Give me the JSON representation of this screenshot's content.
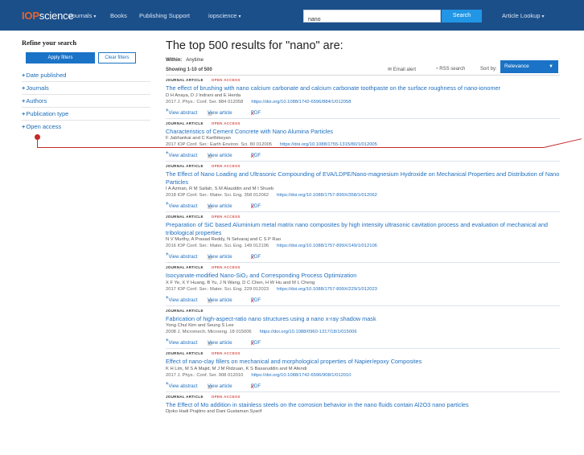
{
  "nav": {
    "logo_prefix": "IOP",
    "logo_suffix": "science",
    "items": [
      "Journals",
      "Books",
      "Publishing Support",
      "iopscience"
    ],
    "search_value": "nano",
    "search_button": "Search",
    "article_lookup": "Article Lookup"
  },
  "sidebar": {
    "title": "Refine your search",
    "apply": "Apply filters",
    "clear": "Clear filters",
    "filters": [
      "Date published",
      "Journals",
      "Authors",
      "Publication type",
      "Open access"
    ]
  },
  "main": {
    "heading": "The top 500 results for \"nano\" are:",
    "within_label": "Within:",
    "within_value": "Anytime",
    "showing": "Showing 1-10 of 500",
    "email_alert": "Email alert",
    "rss": "RSS search",
    "sort_label": "Sort by:",
    "sort_value": "Relevance"
  },
  "labels": {
    "type": "JOURNAL ARTICLE",
    "oa": "OPEN ACCESS",
    "view_abstract": "View abstract",
    "view_article": "View article",
    "pdf": "PDF"
  },
  "results": [
    {
      "title": "The effect of brushing with nano calcium carbonate and calcium carbonate toothpaste on the surface roughness of nano-ionomer",
      "authors": "D H Anaya, D J Indrani and E Herda",
      "cite": "2017 J. Phys.: Conf. Ser. 884 012058",
      "doi": "https://doi.org/10.1088/1742-6596/884/1/012058"
    },
    {
      "title": "Characteristics of Cement Concrete with Nano Alumina Particles",
      "authors": "F Jabhankai and C Karthikeyan",
      "cite": "2017 IOP Conf. Ser.: Earth Environ. Sci. 80 012005",
      "doi": "https://doi.org/10.1088/1755-1315/80/1/012005"
    },
    {
      "title": "The Effect of Nano Loading and Ultrasonic Compounding of EVA/LDPE/Nano-magnesium Hydroxide on Mechanical Properties and Distribution of Nano Particles",
      "authors": "I A Azman, R M Sallah, S M Alauddin and M I Shueb",
      "cite": "2018 IOP Conf. Ser.: Mater. Sci. Eng. 358 012062",
      "doi": "https://doi.org/10.1088/1757-899X/358/1/012062"
    },
    {
      "title": "Preparation of SiC based Aluminium metal matrix nano composites by high intensity ultrasonic cavitation process and evaluation of mechanical and tribological properties",
      "authors": "N V Murthy, A Prasad Reddy, N Selvaraj and C S P Rao",
      "cite": "2016 IOP Conf. Ser.: Mater. Sci. Eng. 149 012106",
      "doi": "https://doi.org/10.1088/1757-899X/149/1/012106"
    },
    {
      "title": "Isocyanate-modified Nano-SiO₂ and Corresponding Process Optimization",
      "authors": "X F Ye, X Y Huang, B Yu, J N Wang, D C Chen, H W Hu and M L Cheng",
      "cite": "2017 IOP Conf. Ser.: Mater. Sci. Eng. 229 012023",
      "doi": "https://doi.org/10.1088/1757-899X/229/1/012023"
    },
    {
      "title": "Fabrication of high-aspect-ratio nano structures using a nano x-ray shadow mask",
      "authors": "Yong Chul Kim and Seung S Lee",
      "cite": "2008 J. Micromech. Microeng. 18 015006",
      "doi": "https://doi.org/10.1088/0960-1317/18/1/015006"
    },
    {
      "title": "Effect of nano-clay fillers on mechanical and morphological properties of Napier/epoxy Composites",
      "authors": "K H Lim, M S A Majid, M J M Ridzuan, K S Basaruddin and M Afendi",
      "cite": "2017 J. Phys.: Conf. Ser. 908 012010",
      "doi": "https://doi.org/10.1088/1742-6596/908/1/012010"
    },
    {
      "title": "The Effect of Mo addition in stainless steels on the corrosion behavior in the nano fluids contain Al2O3 nano particles",
      "authors": "Djoko Hadi Prajitno and Dani Gustaman Syarif",
      "cite": "",
      "doi": ""
    }
  ]
}
